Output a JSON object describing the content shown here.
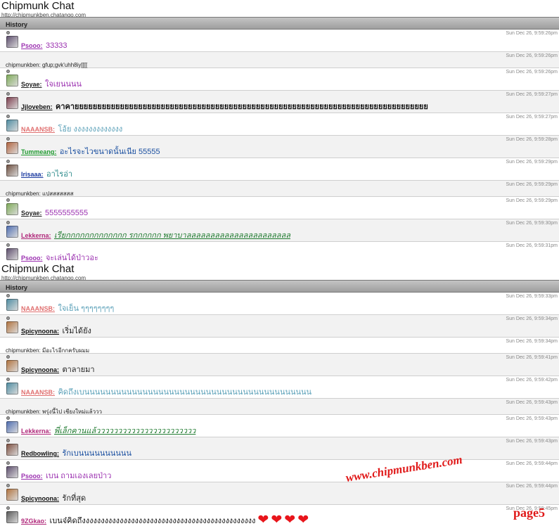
{
  "panels": [
    {
      "title": "Chipmunk Chat",
      "url": "http://chipmunkben.chatango.com",
      "history_label": "History",
      "rows": [
        {
          "kind": "user",
          "name": "Psooo:",
          "text": "33333",
          "time": "Sun Dec 26, 9:59:26pm",
          "name_color": "#9b30b0",
          "text_color": "#9b30b0",
          "avatar": "#5a4a6a"
        },
        {
          "kind": "plain",
          "text": "chipmunkben: gfup;gvk'uhh8iy[[[[",
          "time": "Sun Dec 26, 9:59:26pm"
        },
        {
          "kind": "user",
          "name": "Soyae:",
          "text": "ใจเยนนนน",
          "time": "Sun Dec 26, 9:59:26pm",
          "name_color": "#222222",
          "text_color": "#9b30b0",
          "avatar": "#7caa55"
        },
        {
          "kind": "user",
          "name": "Jjloveben:",
          "text": "คาคายยยยยยยยยยยยยยยยยยยยยยยยยยยยยยยยยยยยยยยยยยยยยยยยยยยยยยยยยยยยยยยยยยยยยยยยยยยยยย",
          "time": "Sun Dec 26, 9:59:27pm",
          "name_color": "#111111",
          "text_color": "#111111",
          "avatar": "#7a3a4a",
          "bold_text": true
        },
        {
          "kind": "user",
          "name": "NAAANSB:",
          "text": "โอ้ย งงงงงงงงงงงงง",
          "time": "Sun Dec 26, 9:59:27pm",
          "name_color": "#e07070",
          "text_color": "#5aa0b8",
          "avatar": "#4a8aa0"
        },
        {
          "kind": "user",
          "name": "Tummeang:",
          "text": "อะไรจะไวขนาดนั้นเนีย 55555",
          "time": "Sun Dec 26, 9:59:28pm",
          "name_color": "#1f9a2f",
          "text_color": "#1a4fa0",
          "avatar": "#b0603a"
        },
        {
          "kind": "user",
          "name": "Irisaaa:",
          "text": "อาไรอ่า",
          "time": "Sun Dec 26, 9:59:29pm",
          "name_color": "#1a3aa0",
          "text_color": "#2a8a8a",
          "avatar": "#6a4a3a"
        },
        {
          "kind": "plain",
          "text": "chipmunkben: แปสสสสสสส",
          "time": "Sun Dec 26, 9:59:29pm"
        },
        {
          "kind": "user",
          "name": "Soyae:",
          "text": "5555555555",
          "time": "Sun Dec 26, 9:59:29pm",
          "name_color": "#222222",
          "text_color": "#9b30b0",
          "avatar": "#7caa55"
        },
        {
          "kind": "user",
          "name": "Lekkerna:",
          "text": "เรียกกกกกกกกกกกกก รกกกกกก พยาบาลลลลลลลลลลลลลลลลลลลลลล",
          "time": "Sun Dec 26, 9:59:30pm",
          "name_color": "#b0287a",
          "text_color": "#1f7a2f",
          "avatar": "#4a6ab0",
          "italic_text": true,
          "underline_text": true
        },
        {
          "kind": "user",
          "name": "Psooo:",
          "text": "จะเล่นได้ป่าวอะ",
          "time": "Sun Dec 26, 9:59:31pm",
          "name_color": "#9b30b0",
          "text_color": "#9b30b0",
          "avatar": "#5a4a6a"
        }
      ]
    },
    {
      "title": "Chipmunk Chat",
      "url": "http://chipmunkben.chatango.com",
      "history_label": "History",
      "rows": [
        {
          "kind": "user",
          "name": "NAAANSB:",
          "text": "ใจเย็น ๆๆๆๆๆๆๆๆ",
          "time": "Sun Dec 26, 9:59:33pm",
          "name_color": "#e07070",
          "text_color": "#5aa0b8",
          "avatar": "#4a8aa0"
        },
        {
          "kind": "user",
          "name": "Spicynoona:",
          "text": "เริ่มได้ยัง",
          "time": "Sun Dec 26, 9:59:34pm",
          "name_color": "#111111",
          "text_color": "#222222",
          "avatar": "#b0703a"
        },
        {
          "kind": "plain",
          "text": "chipmunkben: มีอะไรอีกกครับผมม",
          "time": "Sun Dec 26, 9:59:34pm"
        },
        {
          "kind": "user",
          "name": "Spicynoona:",
          "text": "ตาลายมา",
          "time": "Sun Dec 26, 9:59:41pm",
          "name_color": "#111111",
          "text_color": "#222222",
          "avatar": "#b0703a"
        },
        {
          "kind": "user",
          "name": "NAAANSB:",
          "text": "คิดถึงเบนนนนนนนนนนนนนนนนนนนนนนนนนนนนนนนนนนนนนนนนนนน",
          "time": "Sun Dec 26, 9:59:42pm",
          "name_color": "#e07070",
          "text_color": "#5aa0b8",
          "avatar": "#4a8aa0"
        },
        {
          "kind": "plain",
          "text": "chipmunkben: พรุ่งนี้ไป เชียงใหม่แล้ววว",
          "time": "Sun Dec 26, 9:59:43pm"
        },
        {
          "kind": "user",
          "name": "Lekkerna:",
          "text": "พี่เล็กคานแล้ววววววววววววววววววววววว",
          "time": "Sun Dec 26, 9:59:43pm",
          "name_color": "#b0287a",
          "text_color": "#1f7a2f",
          "avatar": "#4a6ab0",
          "italic_text": true,
          "underline_text": true
        },
        {
          "kind": "user",
          "name": "Redbowling:",
          "text": "รักเบนนนนนนนนนน",
          "time": "Sun Dec 26, 9:59:43pm",
          "name_color": "#111111",
          "text_color": "#1a4fa0",
          "avatar": "#7a4a3a"
        },
        {
          "kind": "user",
          "name": "Psooo:",
          "text": "เบน ถามเองเลยป่าว",
          "time": "Sun Dec 26, 9:59:44pm",
          "name_color": "#9b30b0",
          "text_color": "#9b30b0",
          "avatar": "#5a4a6a"
        },
        {
          "kind": "user",
          "name": "Spicynoona:",
          "text": "รักที่สุด",
          "time": "Sun Dec 26, 9:59:44pm",
          "name_color": "#111111",
          "text_color": "#222222",
          "avatar": "#b0703a"
        },
        {
          "kind": "user",
          "name": "9ZGkao:",
          "text": "เบนจ๋คิดถึงงงงงงงงงงงงงงงงงงงงงงงงงงงงงงงงงงงงงงงงงงงงงง",
          "time": "Sun Dec 26, 9:59:45pm",
          "name_color": "#b0287a",
          "text_color": "#111111",
          "avatar": "#555555",
          "hearts": 4
        }
      ]
    }
  ],
  "watermark": "www.chipmunkben.com",
  "page_label": "page5",
  "heart_glyph": "❤"
}
